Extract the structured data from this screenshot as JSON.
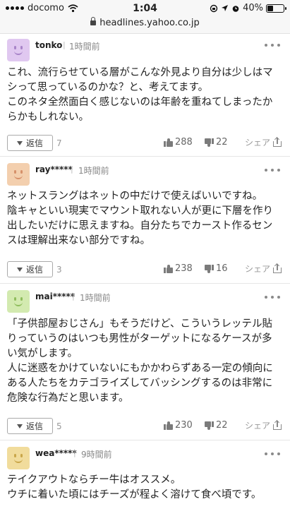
{
  "status_bar": {
    "carrier": "docomo",
    "time": "1:04",
    "battery": "40%",
    "battery_level": 0.4,
    "url": "headlines.yahoo.co.jp"
  },
  "comments": [
    {
      "user": "tonko",
      "time": "1時間前",
      "lines": [
        "これ、流行らせている層がこんな外見より自分は少しはマ",
        "シって思っているのかな？と、考えてます。",
        "このネタ全然面白く感じないのは年齢を重ねてしまったか",
        "らかもしれない。"
      ],
      "reply_label": "返信",
      "reply_count": "7",
      "likes": "288",
      "dislikes": "22",
      "share_label": "シェア"
    },
    {
      "user": "ray*****",
      "time": "1時間前",
      "lines": [
        "ネットスラングはネットの中だけで使えばいいですね。",
        "陰キャといい現実でマウント取れない人が更に下層を作り",
        "出したいだけに思えますね。自分たちでカースト作るセン",
        "スは理解出来ない部分ですね。"
      ],
      "reply_label": "返信",
      "reply_count": "3",
      "likes": "238",
      "dislikes": "16",
      "share_label": "シェア"
    },
    {
      "user": "mai*****",
      "time": "1時間前",
      "lines": [
        "「子供部屋おじさん」もそうだけど、こういうレッテル貼",
        "りっていうのはいつも男性がターゲットになるケースが多",
        "い気がします。",
        "人に迷惑をかけていないにもかかわらずある一定の傾向に",
        "ある人たちをカテゴライズしてバッシングするのは非常に",
        "危険な行為だと思います。"
      ],
      "reply_label": "返信",
      "reply_count": "5",
      "likes": "230",
      "dislikes": "22",
      "share_label": "シェア"
    },
    {
      "user": "wea*****",
      "time": "9時間前",
      "lines": [
        "テイクアウトならチー牛はオススメ。",
        "ウチに着いた頃にはチーズが程よく溶けて食べ頃です。"
      ]
    }
  ],
  "avatar_colors": [
    {
      "bg": "#e0c8f0",
      "fg": "#a884c8"
    },
    {
      "bg": "#f3cfae",
      "fg": "#d6906a"
    },
    {
      "bg": "#d3eab0",
      "fg": "#8fbd5c"
    },
    {
      "bg": "#f1dc9c",
      "fg": "#c9a649"
    }
  ],
  "icons": {
    "more": "more-icon",
    "like": "thumbs-up-icon",
    "dislike": "thumbs-down-icon",
    "share": "share-icon",
    "reply": "triangle-down-icon",
    "lock": "lock-icon"
  }
}
